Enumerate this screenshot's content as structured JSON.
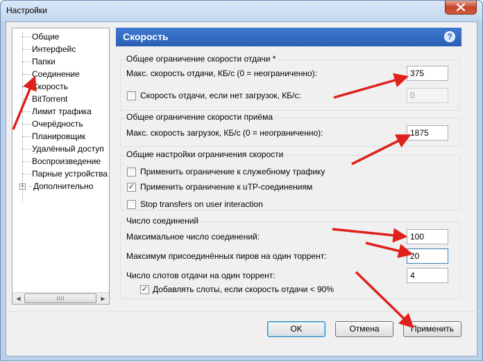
{
  "window": {
    "title": "Настройки"
  },
  "tree": {
    "items": [
      {
        "label": "Общие"
      },
      {
        "label": "Интерфейс"
      },
      {
        "label": "Папки"
      },
      {
        "label": "Соединение"
      },
      {
        "label": "Скорость"
      },
      {
        "label": "BitTorrent"
      },
      {
        "label": "Лимит трафика"
      },
      {
        "label": "Очерёдность"
      },
      {
        "label": "Планировщик"
      },
      {
        "label": "Удалённый доступ"
      },
      {
        "label": "Воспроизведение"
      },
      {
        "label": "Парные устройства"
      },
      {
        "label": "Дополнительно"
      }
    ],
    "expander": "+"
  },
  "panel": {
    "title": "Скорость",
    "help": "?",
    "upload_group": {
      "title": "Общее ограничение скорости отдачи *",
      "max_label": "Макс. скорость отдачи, КБ/с (0 = неограниченно):",
      "max_value": "375",
      "no_download_label": "Скорость отдачи, если нет загрузок, КБ/с:",
      "no_download_value": "0"
    },
    "download_group": {
      "title": "Общее ограничение скорости приёма",
      "max_label": "Макс. скорость загрузок, КБ/с (0 = неограниченно):",
      "max_value": "1875"
    },
    "general_group": {
      "title": "Общие настройки ограничения скорости",
      "overhead_label": "Применить ограничение к служебному трафику",
      "utp_label": "Применить ограничение к uTP-соединениям",
      "stop_label": "Stop transfers on user interaction",
      "utp_checked": "✓"
    },
    "connections_group": {
      "title": "Число соединений",
      "max_conn_label": "Максимальное число соединений:",
      "max_conn_value": "100",
      "peers_label": "Максимум присоединённых пиров на один торрент:",
      "peers_value": "20",
      "slots_label": "Число слотов отдачи на один торрент:",
      "slots_value": "4",
      "extra_slots_label": "Добавлять слоты, если скорость отдачи < 90%",
      "extra_slots_checked": "✓"
    }
  },
  "buttons": {
    "ok": "OK",
    "cancel": "Отмена",
    "apply": "Применить"
  },
  "colors": {
    "header": "#2f69c0",
    "annotation_arrow": "#e0201a"
  }
}
